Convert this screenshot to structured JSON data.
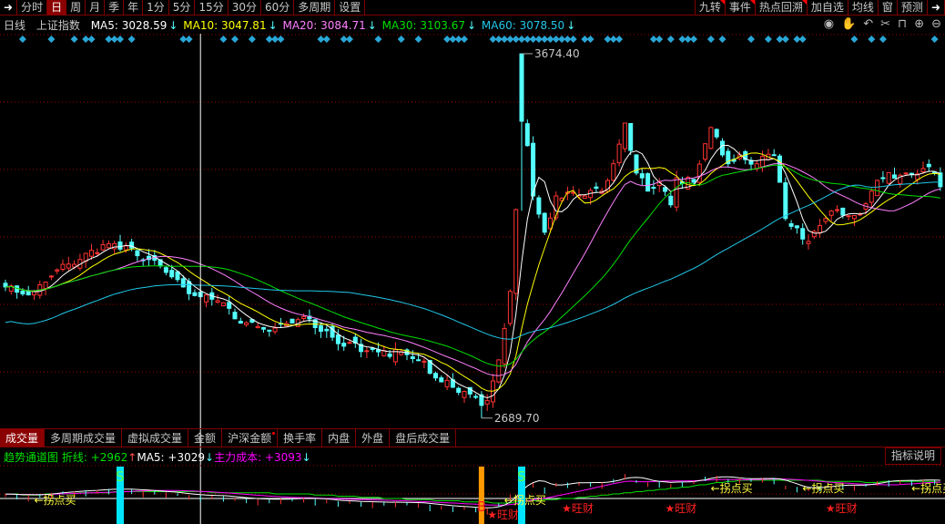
{
  "toolbar": {
    "left": [
      "分时",
      "日",
      "周",
      "月",
      "季",
      "年",
      "1分",
      "5分",
      "15分",
      "30分",
      "60分",
      "多周期",
      "设置"
    ],
    "active": "日",
    "right": [
      "九转",
      "事件",
      "热点回溯",
      "加自选",
      "均线",
      "窗",
      "预测"
    ]
  },
  "info": {
    "period": "日线",
    "index_name": "上证指数",
    "ma5": "MA5: 3028.59",
    "ma10": "MA10: 3047.81",
    "ma20": "MA20: 3084.71",
    "ma30": "MA30: 3103.67",
    "ma60": "MA60: 3078.50",
    "arrow": "↓"
  },
  "chart_icons": [
    "eye-icon",
    "hand-icon",
    "undo-icon",
    "scissors-icon",
    "lock-icon",
    "zoom-in-icon",
    "zoom-out-icon"
  ],
  "colors": {
    "up": "#ff3232",
    "down": "#54ffff",
    "ma5": "#ffffff",
    "ma10": "#ffff00",
    "ma20": "#ff80ff",
    "ma30": "#00e000",
    "ma60": "#20c8e8",
    "grid": "#a00000",
    "signal": "#2aa6d6"
  },
  "chart_data": {
    "type": "candlestick",
    "title": "上证指数 日线",
    "bars": 164,
    "ylim": [
      2667,
      3721
    ],
    "close_keyframes": [
      [
        0,
        3044
      ],
      [
        5,
        3032
      ],
      [
        11,
        3106
      ],
      [
        15,
        3143
      ],
      [
        21,
        3155
      ],
      [
        25,
        3118
      ],
      [
        31,
        3044
      ],
      [
        37,
        3007
      ],
      [
        40,
        2958
      ],
      [
        47,
        2933
      ],
      [
        53,
        2958
      ],
      [
        59,
        2884
      ],
      [
        66,
        2872
      ],
      [
        72,
        2847
      ],
      [
        78,
        2773
      ],
      [
        83,
        2724
      ],
      [
        84,
        2737
      ],
      [
        86,
        2847
      ],
      [
        88,
        3032
      ],
      [
        89,
        3253
      ],
      [
        90,
        3492
      ],
      [
        91,
        3426
      ],
      [
        92,
        3290
      ],
      [
        93,
        3241
      ],
      [
        94,
        3192
      ],
      [
        96,
        3290
      ],
      [
        98,
        3300
      ],
      [
        101,
        3290
      ],
      [
        104,
        3303
      ],
      [
        106,
        3377
      ],
      [
        107,
        3430
      ],
      [
        108,
        3487
      ],
      [
        109,
        3413
      ],
      [
        110,
        3352
      ],
      [
        112,
        3303
      ],
      [
        114,
        3327
      ],
      [
        116,
        3266
      ],
      [
        117,
        3339
      ],
      [
        120,
        3327
      ],
      [
        123,
        3475
      ],
      [
        125,
        3401
      ],
      [
        126,
        3377
      ],
      [
        128,
        3401
      ],
      [
        131,
        3377
      ],
      [
        134,
        3401
      ],
      [
        135,
        3327
      ],
      [
        136,
        3229
      ],
      [
        138,
        3204
      ],
      [
        140,
        3167
      ],
      [
        143,
        3229
      ],
      [
        145,
        3253
      ],
      [
        149,
        3241
      ],
      [
        151,
        3303
      ],
      [
        153,
        3339
      ],
      [
        157,
        3352
      ],
      [
        160,
        3364
      ],
      [
        162,
        3352
      ],
      [
        163,
        3315
      ]
    ],
    "max": {
      "bar": 90,
      "value": 3674.4,
      "label": "3674.40"
    },
    "min": {
      "bar": 83,
      "value": 2689.7,
      "label": "2689.70"
    },
    "ma_periods": [
      5,
      10,
      20,
      30,
      60
    ],
    "signal_bars": [
      3,
      8,
      12,
      14,
      15,
      18,
      19,
      20,
      22,
      31,
      32,
      38,
      40,
      43,
      46,
      47,
      48,
      55,
      56,
      59,
      60,
      65,
      69,
      72,
      77,
      78,
      79,
      80,
      85,
      86,
      87,
      88,
      89,
      90,
      91,
      92,
      93,
      94,
      95,
      96,
      97,
      98,
      99,
      101,
      102,
      105,
      106,
      107,
      113,
      114,
      116,
      118,
      119,
      120,
      123,
      125,
      130,
      133,
      135,
      136,
      138,
      139,
      148,
      151,
      153,
      162
    ],
    "crosshair_bar": 34
  },
  "bottom_tabs": [
    "成交量",
    "多周期成交量",
    "虚拟成交量",
    "金额",
    "沪深金额",
    "换手率",
    "内盘",
    "外盘",
    "盘后成交量"
  ],
  "indicator": {
    "name": "趋势通道图",
    "zx": "折线: +2962",
    "zx_arrow": "↑",
    "ma5": "MA5: +3029",
    "ma5_arrow": "↓",
    "cost": "主力成本: +3093",
    "cost_arrow": "↓",
    "explain": "指标说明",
    "buy_label": "←拐点买",
    "wangcai": "★旺财",
    "s": "S",
    "b": "B",
    "buy_bars": [
      5,
      86,
      122,
      138,
      157
    ],
    "wangcai_bars": [
      84,
      97,
      115,
      143
    ],
    "s_bars": [
      20,
      90
    ],
    "b_bars": [
      83
    ]
  }
}
